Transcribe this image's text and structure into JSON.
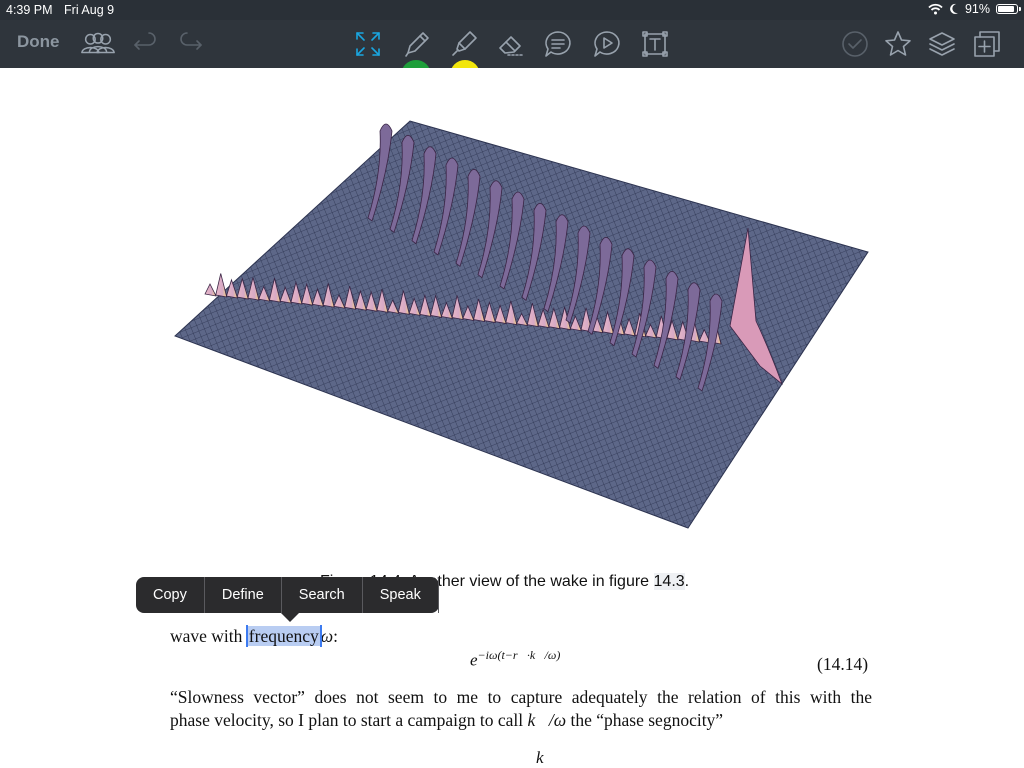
{
  "status_bar": {
    "time": "4:39 PM",
    "date": "Fri Aug 9",
    "battery": "91%",
    "battery_level": 0.91,
    "icons": [
      "wifi-icon",
      "moon-icon",
      "battery-icon"
    ]
  },
  "toolbar": {
    "done_label": "Done",
    "icons": [
      "people-icon",
      "undo-icon",
      "redo-icon",
      "fullscreen-icon",
      "pencil-icon",
      "highlighter-icon",
      "eraser-icon",
      "comment-icon",
      "play-comment-icon",
      "text-box-icon",
      "checkmark-icon",
      "star-icon",
      "layers-icon",
      "add-page-icon"
    ],
    "marker_colors": [
      "#1e9e3a",
      "#f2e60c"
    ],
    "accent": "#1aa6e0"
  },
  "document": {
    "caption_prefix": "Figure 14.4: Another view of the wake in figure ",
    "caption_ref": "14.3",
    "caption_suffix": ".",
    "line1_before": "wave with ",
    "line1_selected": "frequency",
    "line1_after_math": "ω",
    "line1_after": ":",
    "equation_base": "e",
    "equation_exponent": "−iω(t−r⃗·k⃗/ω)",
    "equation_number": "(14.14)",
    "para_line1": "“Slowness vector” does not seem to me to capture adequately the relation of this with the",
    "para_line2_a": "phase velocity, so I plan to start a campaign to call ",
    "para_line2_math": "k⃗/ω",
    "para_line2_b": " the “phase segnocity”",
    "bottom_math": "k⃗"
  },
  "context_menu": {
    "items": [
      "Copy",
      "Define",
      "Search",
      "Speak"
    ]
  }
}
